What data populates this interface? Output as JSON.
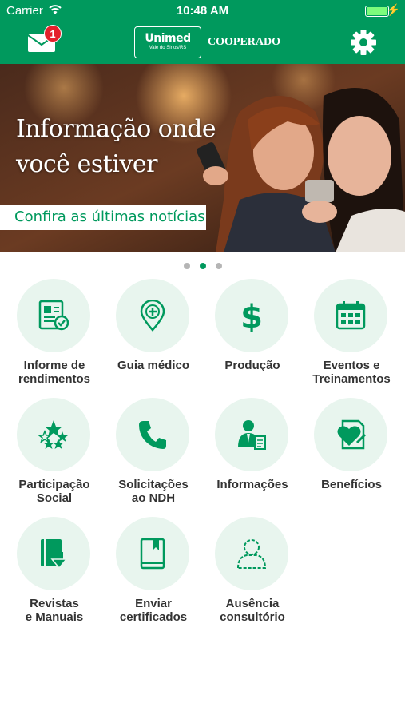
{
  "status_bar": {
    "carrier": "Carrier",
    "time": "10:48 AM",
    "battery_level": 1.0
  },
  "header": {
    "notification_count": "1",
    "logo_brand": "Unimed",
    "logo_subtitle": "Vale do Sinos/RS",
    "title": "COOPERADO",
    "icons": [
      "mail-icon",
      "settings-gear-icon"
    ]
  },
  "banner": {
    "headline_line1": "Informação onde",
    "headline_line2": "você estiver",
    "cta": "Confira as últimas notícias"
  },
  "carousel": {
    "pages": 3,
    "active_index": 1
  },
  "menu": [
    {
      "label": "Informe de\nrendimentos",
      "icon": "income-report-icon"
    },
    {
      "label": "Guia médico",
      "icon": "medical-location-pin-icon"
    },
    {
      "label": "Produção",
      "icon": "dollar-icon"
    },
    {
      "label": "Eventos e\nTreinamentos",
      "icon": "calendar-icon"
    },
    {
      "label": "Participação\nSocial",
      "icon": "stars-icon"
    },
    {
      "label": "Solicitações\nao NDH",
      "icon": "phone-icon"
    },
    {
      "label": "Informações",
      "icon": "person-document-icon"
    },
    {
      "label": "Benefícios",
      "icon": "heart-document-icon"
    },
    {
      "label": "Revistas\ne Manuais",
      "icon": "book-download-icon"
    },
    {
      "label": "Enviar\ncertificados",
      "icon": "bookmark-book-icon"
    },
    {
      "label": "Ausência\nconsultório",
      "icon": "absent-person-icon"
    }
  ],
  "colors": {
    "brand_green": "#00995d",
    "tile_background": "#e8f5ee",
    "badge_red": "#e4212c"
  }
}
